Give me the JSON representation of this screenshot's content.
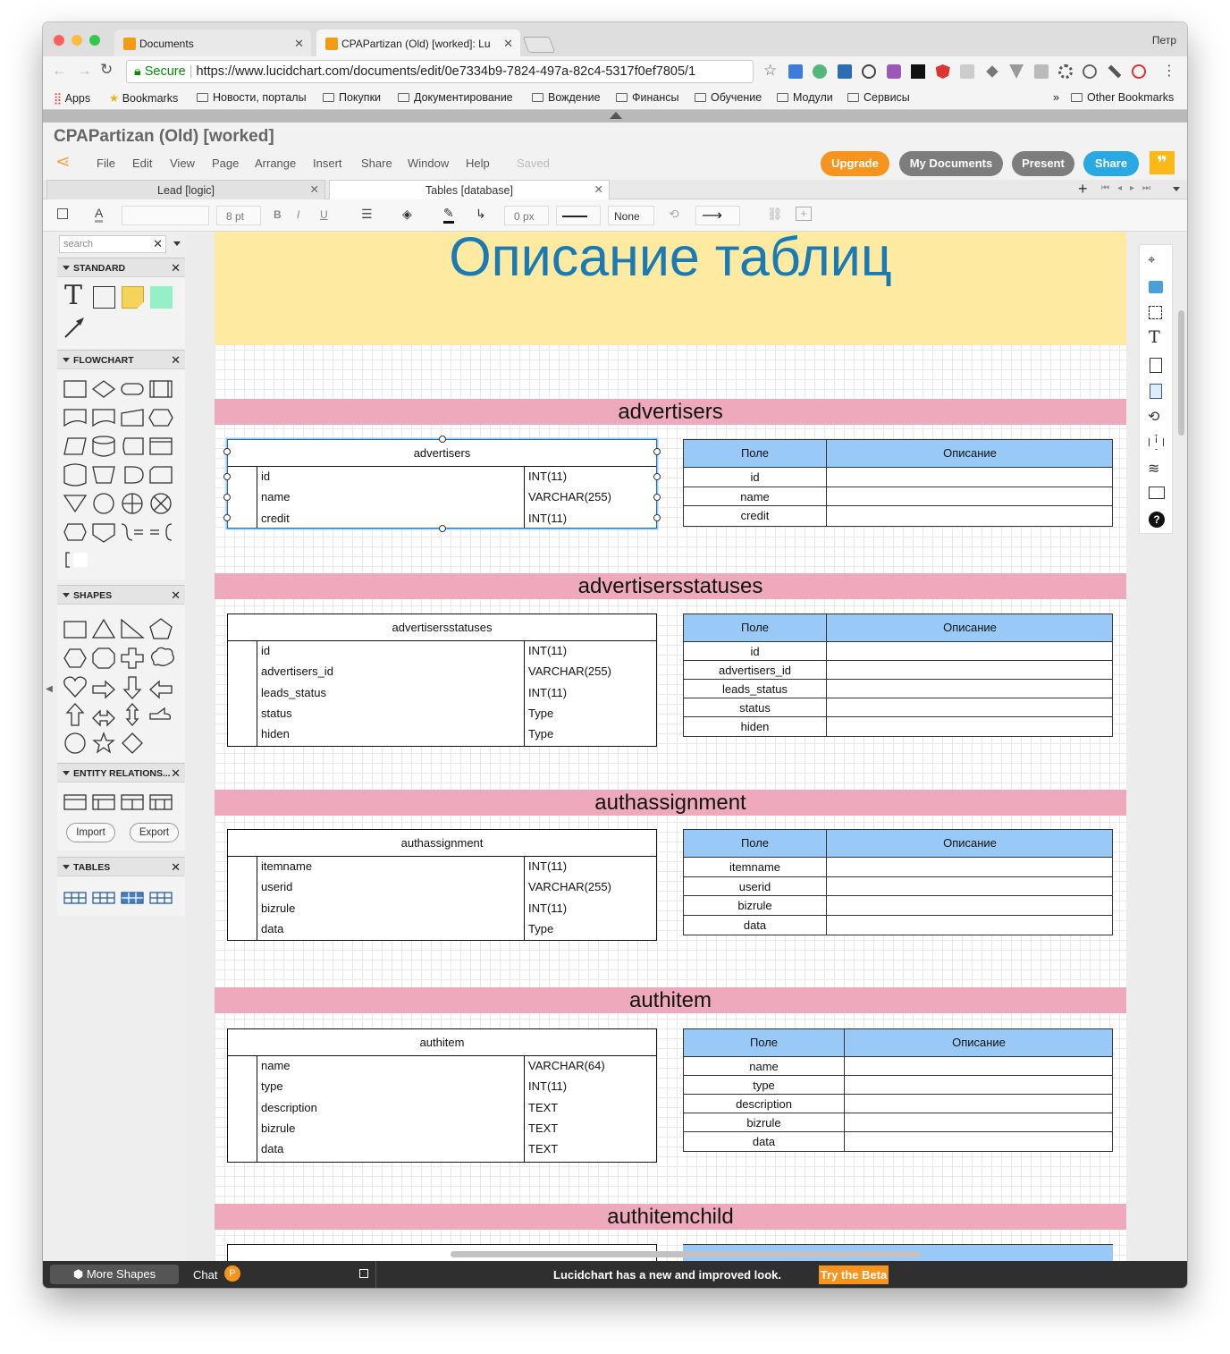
{
  "browser": {
    "tabs": [
      {
        "label": "Documents"
      },
      {
        "label": "CPAPartizan (Old) [worked]: Lu"
      }
    ],
    "user": "Петр",
    "secure": "Secure",
    "url": "https://www.lucidchart.com/documents/edit/0e7334b9-7824-497a-82c4-5317f0ef7805/1",
    "bookmarks": [
      "Apps",
      "Bookmarks",
      "Новости, порталы",
      "Покупки",
      "Документирование",
      "Вождение",
      "Финансы",
      "Обучение",
      "Модули",
      "Сервисы"
    ],
    "more": "»",
    "other_bookmarks": "Other Bookmarks"
  },
  "app": {
    "doc_title": "CPAPartizan (Old) [worked]",
    "menu": [
      "File",
      "Edit",
      "View",
      "Page",
      "Arrange",
      "Insert",
      "Share",
      "Window",
      "Help"
    ],
    "saved": "Saved",
    "buttons": {
      "upgrade": "Upgrade",
      "my_documents": "My Documents",
      "present": "Present",
      "share": "Share"
    },
    "colors": {
      "upgrade": "#f7941d",
      "gray": "#7d7d7d",
      "share": "#29a9e1",
      "feedback": "#fbb917"
    },
    "pages": [
      {
        "label": "Lead [logic]"
      },
      {
        "label": "Tables [database]"
      }
    ],
    "toolbar": {
      "font_size": "8 pt",
      "line_width": "0 px",
      "arrow_start": "None"
    }
  },
  "left_panel": {
    "search_placeholder": "search",
    "sections": [
      "STANDARD",
      "FLOWCHART",
      "SHAPES",
      "ENTITY RELATIONS...",
      "TABLES"
    ],
    "import": "Import",
    "export": "Export",
    "more_shapes": "More Shapes"
  },
  "canvas": {
    "heading": "Описание таблиц",
    "col_field": "Поле",
    "col_desc": "Описание",
    "tables": [
      {
        "name": "advertisers",
        "rows": [
          {
            "n": "id",
            "t": "INT(11)"
          },
          {
            "n": "name",
            "t": "VARCHAR(255)"
          },
          {
            "n": "credit",
            "t": "INT(11)"
          }
        ]
      },
      {
        "name": "advertisersstatuses",
        "rows": [
          {
            "n": "id",
            "t": "INT(11)"
          },
          {
            "n": "advertisers_id",
            "t": "VARCHAR(255)"
          },
          {
            "n": "leads_status",
            "t": "INT(11)"
          },
          {
            "n": "status",
            "t": "Type"
          },
          {
            "n": "hiden",
            "t": "Type"
          }
        ]
      },
      {
        "name": "authassignment",
        "rows": [
          {
            "n": "itemname",
            "t": "INT(11)"
          },
          {
            "n": "userid",
            "t": "VARCHAR(255)"
          },
          {
            "n": "bizrule",
            "t": "INT(11)"
          },
          {
            "n": "data",
            "t": "Type"
          }
        ]
      },
      {
        "name": "authitem",
        "rows": [
          {
            "n": "name",
            "t": "VARCHAR(64)"
          },
          {
            "n": "type",
            "t": "INT(11)"
          },
          {
            "n": "description",
            "t": "TEXT"
          },
          {
            "n": "bizrule",
            "t": "TEXT"
          },
          {
            "n": "data",
            "t": "TEXT"
          }
        ]
      },
      {
        "name": "authitemchild",
        "rows": []
      }
    ]
  },
  "bottom": {
    "chat": "Chat",
    "chat_badge": "P",
    "notice": "Lucidchart has a new and improved look.",
    "beta": "Try the Beta"
  }
}
